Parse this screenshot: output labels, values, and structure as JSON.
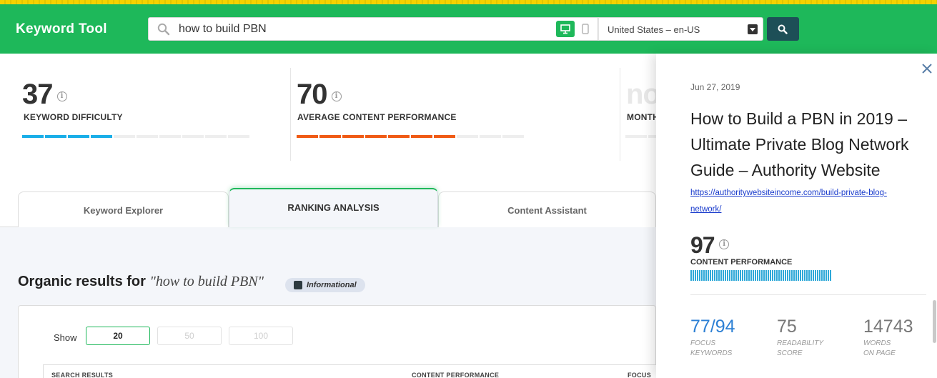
{
  "header": {
    "logo": "Keyword Tool",
    "search_value": "how to build PBN",
    "locale": "United States – en-US"
  },
  "stats": [
    {
      "value": "37",
      "label": "KEYWORD DIFFICULTY",
      "filled_segments": 4,
      "total_segments": 10,
      "color": "#19aee8"
    },
    {
      "value": "70",
      "label": "AVERAGE CONTENT PERFORMANCE",
      "filled_segments": 7,
      "total_segments": 10,
      "color": "#f05a14"
    },
    {
      "value": "no",
      "label": "MONTH",
      "filled_segments": 0,
      "total_segments": 2,
      "color": "#eeeeee"
    }
  ],
  "tabs": [
    {
      "label": "Keyword Explorer",
      "active": false
    },
    {
      "label": "RANKING ANALYSIS",
      "active": true
    },
    {
      "label": "Content Assistant",
      "active": false
    }
  ],
  "organic": {
    "title": "Organic results for",
    "query": "\"how to build PBN\"",
    "intent": "Informational"
  },
  "results": {
    "show_label": "Show",
    "show_options": [
      "20",
      "50",
      "100"
    ],
    "columns": [
      "SEARCH RESULTS",
      "CONTENT PERFORMANCE",
      "FOCUS"
    ]
  },
  "panel": {
    "date": "Jun 27, 2019",
    "title": "How to Build a PBN in 2019 – Ultimate Private Blog Network Guide – Authority Website",
    "link_line1": "https://authoritywebsiteincome.com/build-private-blog-",
    "link_line2": "network/",
    "score": "97",
    "score_label": "CONTENT PERFORMANCE",
    "score_fraction": 0.97,
    "metrics": [
      {
        "value_a": "77",
        "value_b": "/94",
        "label1": "FOCUS",
        "label2": "KEYWORDS"
      },
      {
        "value_a": "75",
        "value_b": "",
        "label1": "READABILITY",
        "label2": "SCORE"
      },
      {
        "value_a": "14743",
        "value_b": "",
        "label1": "WORDS",
        "label2": "ON PAGE"
      }
    ]
  },
  "colors": {
    "brand_green": "#1eb85a",
    "difficulty_blue": "#19aee8",
    "performance_orange": "#f05a14",
    "link_blue": "#1a3ccc",
    "accent_blue": "#2b7fd4"
  }
}
